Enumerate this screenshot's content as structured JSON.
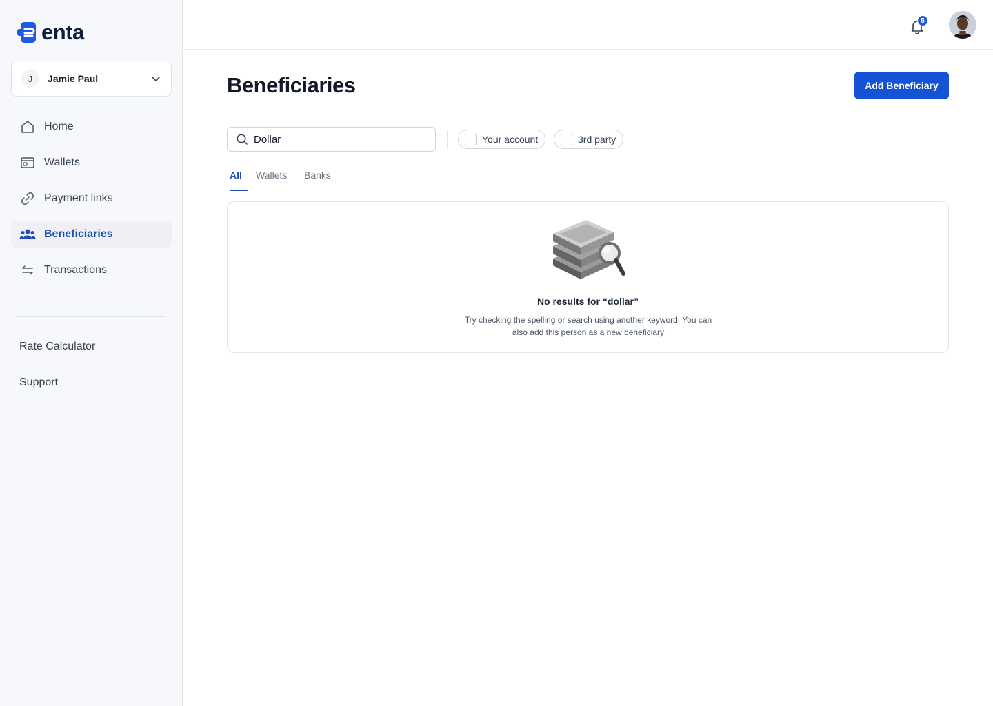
{
  "app": {
    "logo_text": "enta",
    "brand_color": "#1453d6"
  },
  "account": {
    "initial": "J",
    "name": "Jamie Paul"
  },
  "nav": {
    "items": [
      {
        "label": "Home",
        "icon": "home-icon"
      },
      {
        "label": "Wallets",
        "icon": "wallet-icon"
      },
      {
        "label": "Payment links",
        "icon": "link-icon"
      },
      {
        "label": "Beneficiaries",
        "icon": "users-icon",
        "active": true
      },
      {
        "label": "Transactions",
        "icon": "arrows-swap-icon"
      }
    ],
    "extra": [
      "Rate Calculator",
      "Support"
    ]
  },
  "header": {
    "notification_count": "5"
  },
  "page": {
    "title": "Beneficiaries",
    "add_button": "Add Beneficiary"
  },
  "search": {
    "value": "Dollar",
    "placeholder": "Search"
  },
  "filters": {
    "your_account": "Your account",
    "third_party": "3rd party"
  },
  "tabs": [
    "All",
    "Wallets",
    "Banks"
  ],
  "empty_state": {
    "title": "No results for “dollar”",
    "description": "Try checking the spelling or search using another keyword. You can also add this person as a new beneficiary"
  }
}
